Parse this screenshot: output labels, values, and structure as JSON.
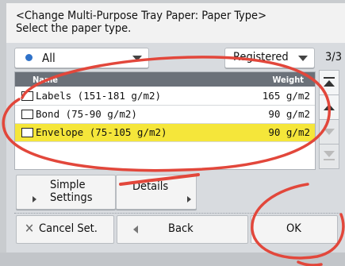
{
  "header": {
    "title": "<Change Multi-Purpose Tray Paper: Paper Type>",
    "subtitle": "Select the paper type."
  },
  "filters": {
    "category": "All",
    "registered": "Registered",
    "page": "3/3"
  },
  "table": {
    "columns": [
      "Name",
      "Weight"
    ],
    "rows": [
      {
        "name": "Labels (151-181 g/m2)",
        "weight": "165 g/m2",
        "selected": false
      },
      {
        "name": "Bond (75-90 g/m2)",
        "weight": "90  g/m2",
        "selected": false
      },
      {
        "name": "Envelope (75-105 g/m2)",
        "weight": "90  g/m2",
        "selected": true
      }
    ]
  },
  "buttons": {
    "simple_settings": "Simple\nSettings",
    "details": "Details",
    "cancel": "Cancel Set.",
    "back": "Back",
    "ok": "OK"
  },
  "colors": {
    "selected_row": "#f5e63a",
    "annotation_stroke": "#e2473b"
  },
  "icons": [
    "labels-icon",
    "bond-icon",
    "envelope-icon",
    "scroll-top-icon",
    "scroll-up-icon",
    "scroll-down-icon",
    "scroll-bottom-icon"
  ]
}
